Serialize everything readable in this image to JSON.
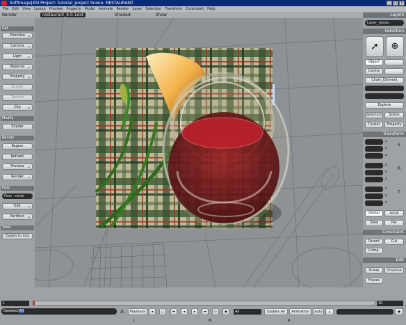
{
  "title": "Softimage|XSI Project: tutorial_project    Scene: RESTAURANT",
  "window_buttons": [
    "_",
    "□",
    "x"
  ],
  "menu": [
    "File",
    "Edit",
    "View",
    "Layout",
    "Preview",
    "Property",
    "Model",
    "Animate",
    "Render",
    "Layer",
    "Selection",
    "Transform",
    "Constraint",
    "Help"
  ],
  "toolbar": {
    "panel": "Render",
    "camera": "restaurant_6.0.1ext",
    "pp_mode": "Shaded",
    "view_mode": "Show"
  },
  "left": {
    "get": {
      "header": "Get",
      "items": [
        "Primitive",
        "Camera",
        "Light",
        "Material",
        "Property",
        "Shader",
        "Texture",
        "Clip"
      ]
    },
    "modify": {
      "header": "Modify",
      "items": [
        "Shader"
      ]
    },
    "render": {
      "header": "Render",
      "items": [
        "Region",
        "Refresh",
        "Preview",
        "Render"
      ]
    },
    "pass": {
      "header": "Pass",
      "current": "Pass - resto",
      "items": [
        "Edit",
        "Partition"
      ]
    },
    "tools": {
      "header": "Tools",
      "items": [
        "Export to mi2"
      ]
    }
  },
  "right": {
    "layers_header": "Layers",
    "layer_field": "Layer_restau",
    "selection_header": "Selection",
    "object": "Object",
    "centre": "Centre",
    "chain": "Chain_Element",
    "explore": "Explore",
    "selection": "Selection",
    "scene": "Scene",
    "cluster": "Cluster",
    "property": "Property",
    "transform_header": "Transform",
    "axes": [
      "x",
      "y",
      "z"
    ],
    "global": "Global",
    "local": "Local",
    "view": "View",
    "par": "Par",
    "constraint_header": "Constraint",
    "parent": "Parent",
    "cut": "Cut",
    "comp": "Comp.",
    "edit_header": "Edit",
    "group": "Group",
    "ungroup": "Ungroup",
    "freeze": "Freeze"
  },
  "timeline": {
    "start": "1",
    "end": "30",
    "current": "1"
  },
  "bottom": {
    "status_prefix": "Deselect",
    "status_highlight": "All",
    "playback": "Playback",
    "frame": "1",
    "all": "All",
    "update_all": "Update All",
    "animation": "Animation",
    "auto": "auto",
    "mouse": [
      "L",
      "M",
      "R"
    ]
  }
}
